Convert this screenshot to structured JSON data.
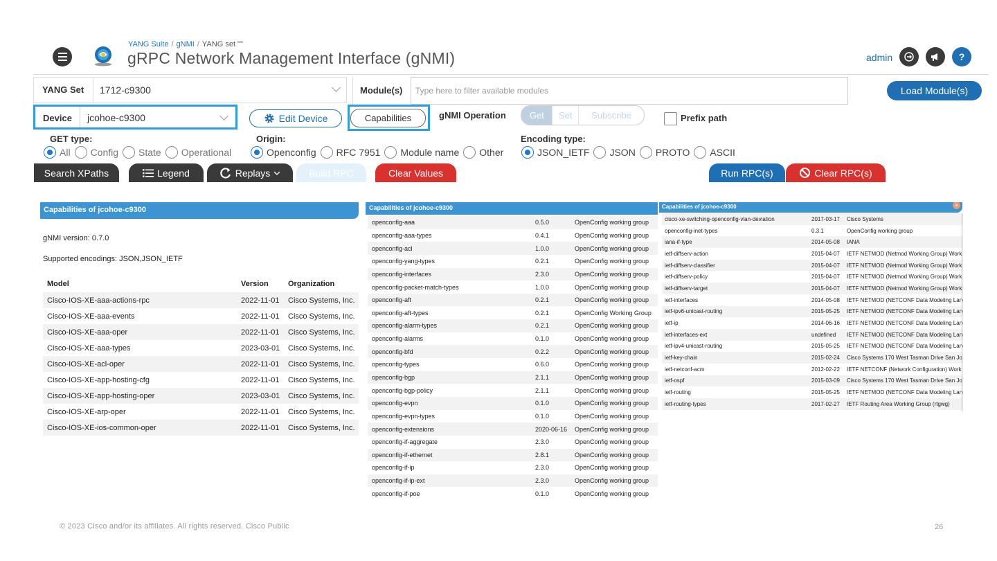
{
  "header": {
    "breadcrumb": [
      "YANG Suite",
      "gNMI",
      "YANG set \"\""
    ],
    "title": "gRPC Network Management Interface (gNMI)",
    "user": "admin",
    "help_glyph": "?",
    "icons": [
      "menu-icon",
      "logo-icon",
      "logout-icon",
      "announce-icon",
      "help-icon"
    ]
  },
  "toolbar": {
    "yang_set_label": "YANG Set",
    "yang_set_value": "1712-c9300",
    "modules_label": "Module(s)",
    "modules_placeholder": "Type here to filter available modules",
    "load_modules": "Load Module(s)",
    "device_label": "Device",
    "device_value": "jcohoe-c9300",
    "edit_device": "Edit Device",
    "capabilities": "Capabilities",
    "gnmi_operation_label": "gNMI Operation",
    "operations": [
      "Get",
      "Set",
      "Subscribe"
    ],
    "operation_selected": "Get",
    "prefix_path": "Prefix path"
  },
  "options": {
    "get_type_label": "GET type:",
    "get_types": [
      "All",
      "Config",
      "State",
      "Operational"
    ],
    "get_type_selected": "All",
    "origin_label": "Origin:",
    "origins": [
      "Openconfig",
      "RFC 7951",
      "Module name",
      "Other"
    ],
    "origin_selected": "Openconfig",
    "encoding_label": "Encoding type:",
    "encodings": [
      "JSON_IETF",
      "JSON",
      "PROTO",
      "ASCII"
    ],
    "encoding_selected": "JSON_IETF"
  },
  "actions": {
    "search_xpaths": "Search XPaths",
    "legend": "Legend",
    "replays": "Replays",
    "build_rpc": "Build RPC",
    "clear_values": "Clear Values",
    "run_rpcs": "Run RPC(s)",
    "clear_rpcs": "Clear RPC(s)",
    "colors": {
      "dark": "#3a3a3a",
      "red": "#d9322e",
      "blue": "#1f6fb5",
      "panel": "#3c94d3"
    }
  },
  "panel1": {
    "title": "Capabilities of jcohoe-c9300",
    "gnmi_version": "gNMI version: 0.7.0",
    "encodings": "Supported encodings: JSON,JSON_IETF",
    "columns": [
      "Model",
      "Version",
      "Organization"
    ],
    "rows": [
      [
        "Cisco-IOS-XE-aaa-actions-rpc",
        "2022-11-01",
        "Cisco Systems, Inc."
      ],
      [
        "Cisco-IOS-XE-aaa-events",
        "2022-11-01",
        "Cisco Systems, Inc."
      ],
      [
        "Cisco-IOS-XE-aaa-oper",
        "2022-11-01",
        "Cisco Systems, Inc."
      ],
      [
        "Cisco-IOS-XE-aaa-types",
        "2023-03-01",
        "Cisco Systems, Inc."
      ],
      [
        "Cisco-IOS-XE-acl-oper",
        "2022-11-01",
        "Cisco Systems, Inc."
      ],
      [
        "Cisco-IOS-XE-app-hosting-cfg",
        "2022-11-01",
        "Cisco Systems, Inc."
      ],
      [
        "Cisco-IOS-XE-app-hosting-oper",
        "2023-03-01",
        "Cisco Systems, Inc."
      ],
      [
        "Cisco-IOS-XE-arp-oper",
        "2022-11-01",
        "Cisco Systems, Inc."
      ],
      [
        "Cisco-IOS-XE-ios-common-oper",
        "2022-11-01",
        "Cisco Systems, Inc."
      ]
    ]
  },
  "panel2": {
    "title": "Capabilities of jcohoe-c9300",
    "rows": [
      [
        "openconfig-aaa",
        "0.5.0",
        "OpenConfig working group"
      ],
      [
        "openconfig-aaa-types",
        "0.4.1",
        "OpenConfig working group"
      ],
      [
        "openconfig-acl",
        "1.0.0",
        "OpenConfig working group"
      ],
      [
        "openconfig-yang-types",
        "0.2.1",
        "OpenConfig working group"
      ],
      [
        "openconfig-interfaces",
        "2.3.0",
        "OpenConfig working group"
      ],
      [
        "openconfig-packet-match-types",
        "1.0.0",
        "OpenConfig working group"
      ],
      [
        "openconfig-aft",
        "0.2.1",
        "OpenConfig working group"
      ],
      [
        "openconfig-aft-types",
        "0.2.1",
        "OpenConfig Working Group"
      ],
      [
        "openconfig-alarm-types",
        "0.2.1",
        "OpenConfig working group"
      ],
      [
        "openconfig-alarms",
        "0.1.0",
        "OpenConfig working group"
      ],
      [
        "openconfig-bfd",
        "0.2.2",
        "OpenConfig working group"
      ],
      [
        "openconfig-types",
        "0.6.0",
        "OpenConfig working group"
      ],
      [
        "openconfig-bgp",
        "2.1.1",
        "OpenConfig working group"
      ],
      [
        "openconfig-bgp-policy",
        "2.1.1",
        "OpenConfig working group"
      ],
      [
        "openconfig-evpn",
        "0.1.0",
        "OpenConfig working group"
      ],
      [
        "openconfig-evpn-types",
        "0.1.0",
        "OpenConfig working group"
      ],
      [
        "openconfig-extensions",
        "2020-06-16",
        "OpenConfig working group"
      ],
      [
        "openconfig-if-aggregate",
        "2.3.0",
        "OpenConfig working group"
      ],
      [
        "openconfig-if-ethernet",
        "2.8.1",
        "OpenConfig working group"
      ],
      [
        "openconfig-if-ip",
        "2.3.0",
        "OpenConfig working group"
      ],
      [
        "openconfig-if-ip-ext",
        "2.3.0",
        "OpenConfig working group"
      ],
      [
        "openconfig-if-poe",
        "0.1.0",
        "OpenConfig working group"
      ]
    ]
  },
  "panel3": {
    "title": "Capabilities of jcohoe-c9300",
    "close_glyph": "×",
    "rows": [
      [
        "cisco-xe-switching-openconfig-vlan-deviation",
        "2017-03-17",
        "Cisco Systems"
      ],
      [
        "openconfig-inet-types",
        "0.3.1",
        "OpenConfig working group"
      ],
      [
        "iana-if-type",
        "2014-05-08",
        "IANA"
      ],
      [
        "ietf-diffserv-action",
        "2015-04-07",
        "IETF NETMOD (Netmod Working Group) Work"
      ],
      [
        "ietf-diffserv-classifier",
        "2015-04-07",
        "IETF NETMOD (Netmod Working Group) Work"
      ],
      [
        "ietf-diffserv-policy",
        "2015-04-07",
        "IETF NETMOD (Netmod Working Group) Work"
      ],
      [
        "ietf-diffserv-target",
        "2015-04-07",
        "IETF NETMOD (Netmod Working Group) Work"
      ],
      [
        "ietf-interfaces",
        "2014-05-08",
        "IETF NETMOD (NETCONF Data Modeling Lang"
      ],
      [
        "ietf-ipv6-unicast-routing",
        "2015-05-25",
        "IETF NETMOD (NETCONF Data Modeling Lang"
      ],
      [
        "ietf-ip",
        "2014-06-16",
        "IETF NETMOD (NETCONF Data Modeling Lang"
      ],
      [
        "ietf-interfaces-ext",
        "undefined",
        "IETF NETMOD (NETCONF Data Modeling Lang"
      ],
      [
        "ietf-ipv4-unicast-routing",
        "2015-05-25",
        "IETF NETMOD (NETCONF Data Modeling Lang"
      ],
      [
        "ietf-key-chain",
        "2015-02-24",
        "Cisco Systems 170 West Tasman Drive San Jo"
      ],
      [
        "ietf-netconf-acm",
        "2012-02-22",
        "IETF NETCONF (Network Configuration) Worki"
      ],
      [
        "ietf-ospf",
        "2015-03-09",
        "Cisco Systems 170 West Tasman Drive San Jo"
      ],
      [
        "ietf-routing",
        "2015-05-25",
        "IETF NETMOD (NETCONF Data Modeling Lang"
      ],
      [
        "ietf-routing-types",
        "2017-02-27",
        "IETF Routing Area Working Group (rtgwg)"
      ]
    ]
  },
  "footer": {
    "copyright": "© 2023  Cisco and/or its affiliates. All rights reserved.   Cisco Public",
    "page_number": "26"
  }
}
